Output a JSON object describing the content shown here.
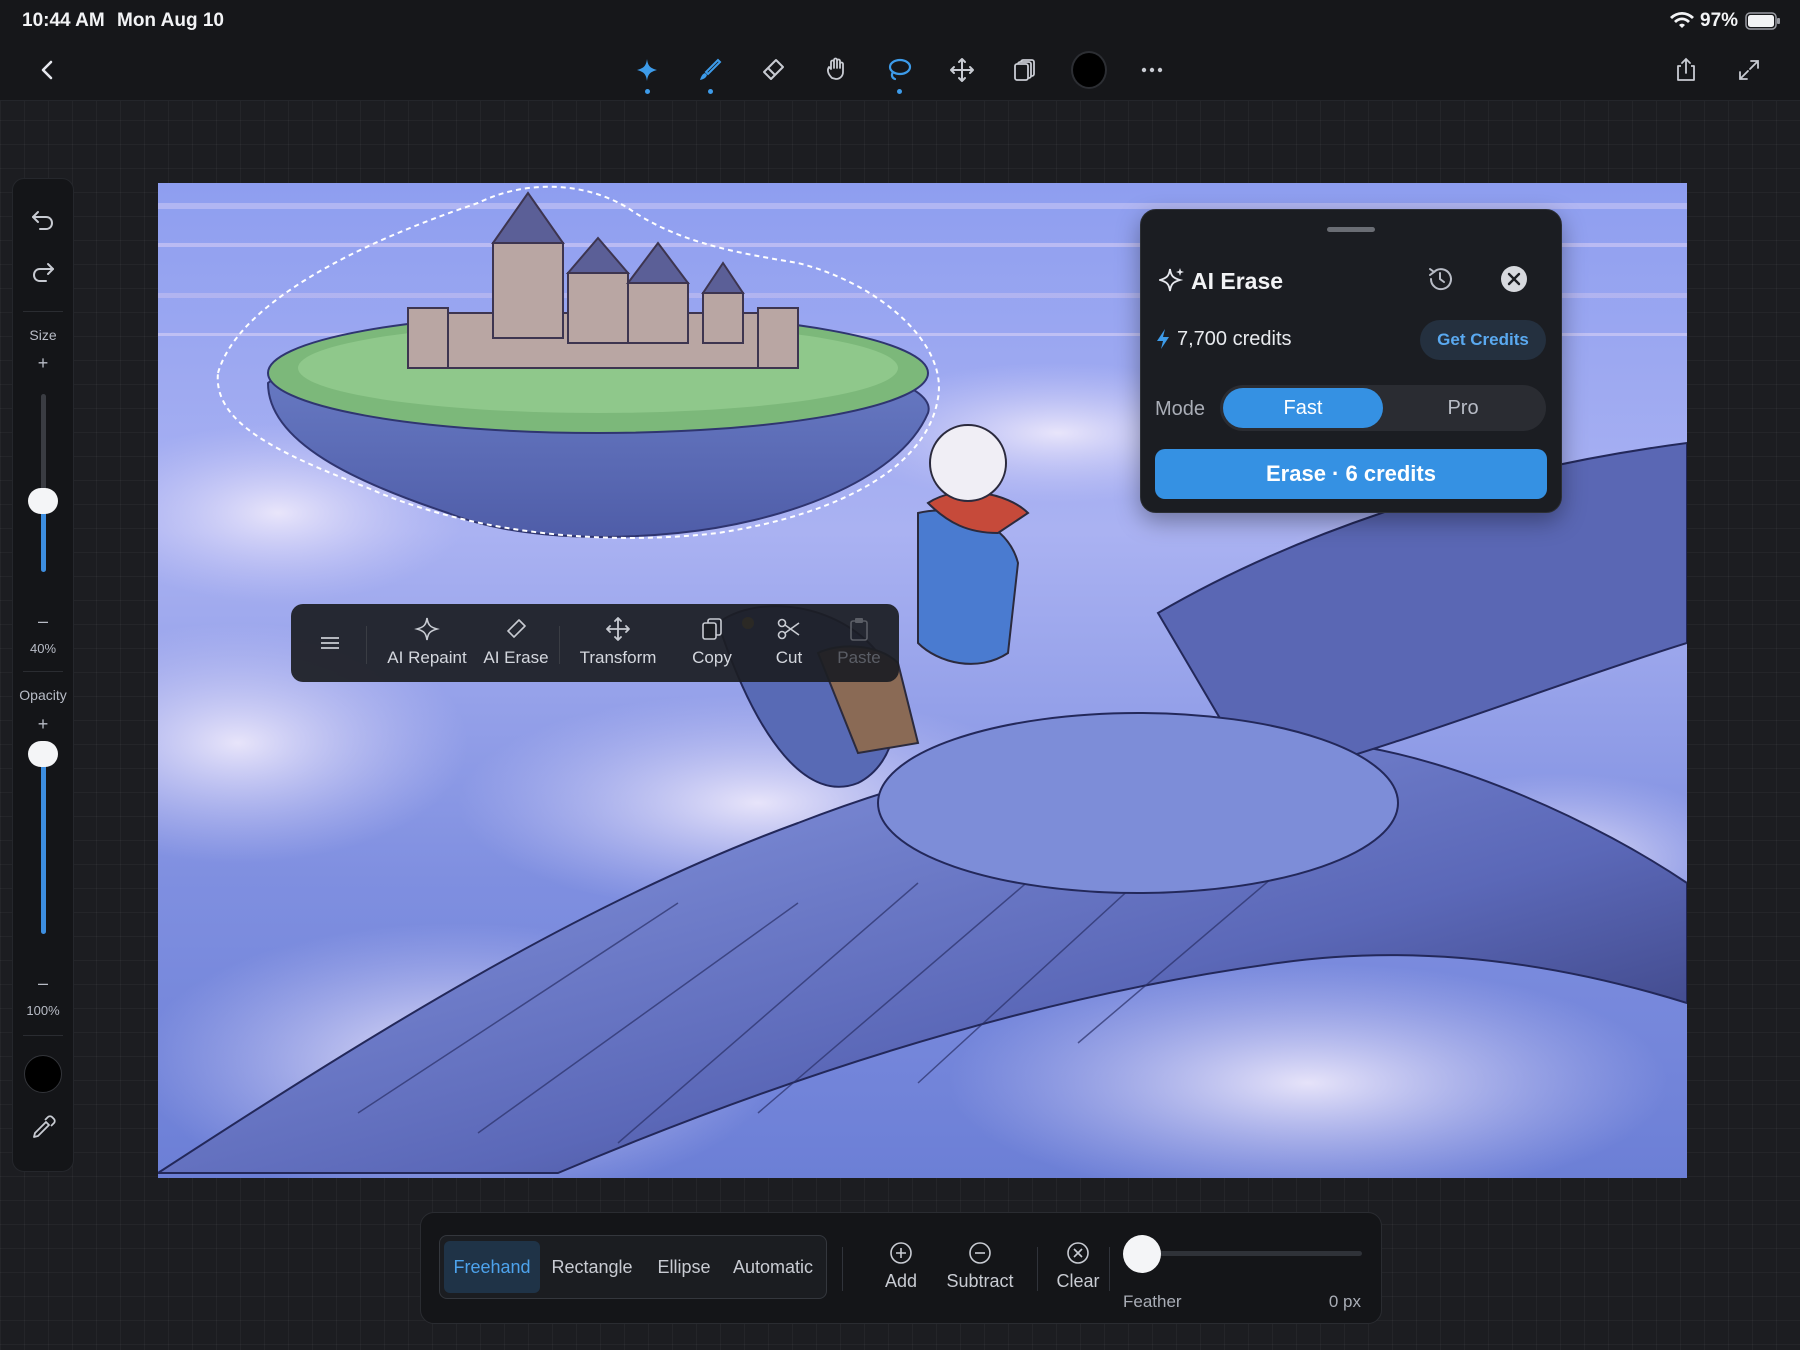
{
  "status_bar": {
    "time": "10:44 AM",
    "date": "Mon Aug 10",
    "battery": "97%"
  },
  "top_toolbar": {
    "tools": [
      "sparkle-icon",
      "brush-icon",
      "eraser-icon",
      "smudge-icon",
      "lasso-icon",
      "move-icon",
      "layers-icon",
      "color-swatch",
      "more-icon"
    ],
    "active_tools": [
      "sparkle-icon",
      "brush-icon",
      "lasso-icon"
    ],
    "swatch_color": "#000000"
  },
  "sidebar": {
    "size_label": "Size",
    "size_value": "40%",
    "size_level": 0.4,
    "opacity_label": "Opacity",
    "opacity_value": "100%",
    "opacity_level": 1.0,
    "plus": "+",
    "minus": "–",
    "color": "#000000"
  },
  "context_menu": {
    "items": [
      {
        "label": "AI Repaint",
        "icon": "sparkle-icon"
      },
      {
        "label": "AI Erase",
        "icon": "eraser-icon"
      },
      {
        "label": "Transform",
        "icon": "move-icon"
      },
      {
        "label": "Copy",
        "icon": "copy-icon"
      },
      {
        "label": "Cut",
        "icon": "scissors-icon"
      },
      {
        "label": "Paste",
        "icon": "paste-icon",
        "disabled": true
      }
    ]
  },
  "ai_erase_panel": {
    "title": "AI Erase",
    "credits": "7,700 credits",
    "get_credits": "Get Credits",
    "mode_label": "Mode",
    "modes": [
      "Fast",
      "Pro"
    ],
    "selected_mode": "Fast",
    "erase_button": "Erase · 6 credits"
  },
  "bottom_bar": {
    "selection_shapes": [
      "Freehand",
      "Rectangle",
      "Ellipse",
      "Automatic"
    ],
    "selected_shape": "Freehand",
    "add_label": "Add",
    "subtract_label": "Subtract",
    "clear_label": "Clear",
    "feather_label": "Feather",
    "feather_value": "0 px"
  },
  "colors": {
    "accent": "#3591e3",
    "accent_text": "#4da3ec"
  }
}
